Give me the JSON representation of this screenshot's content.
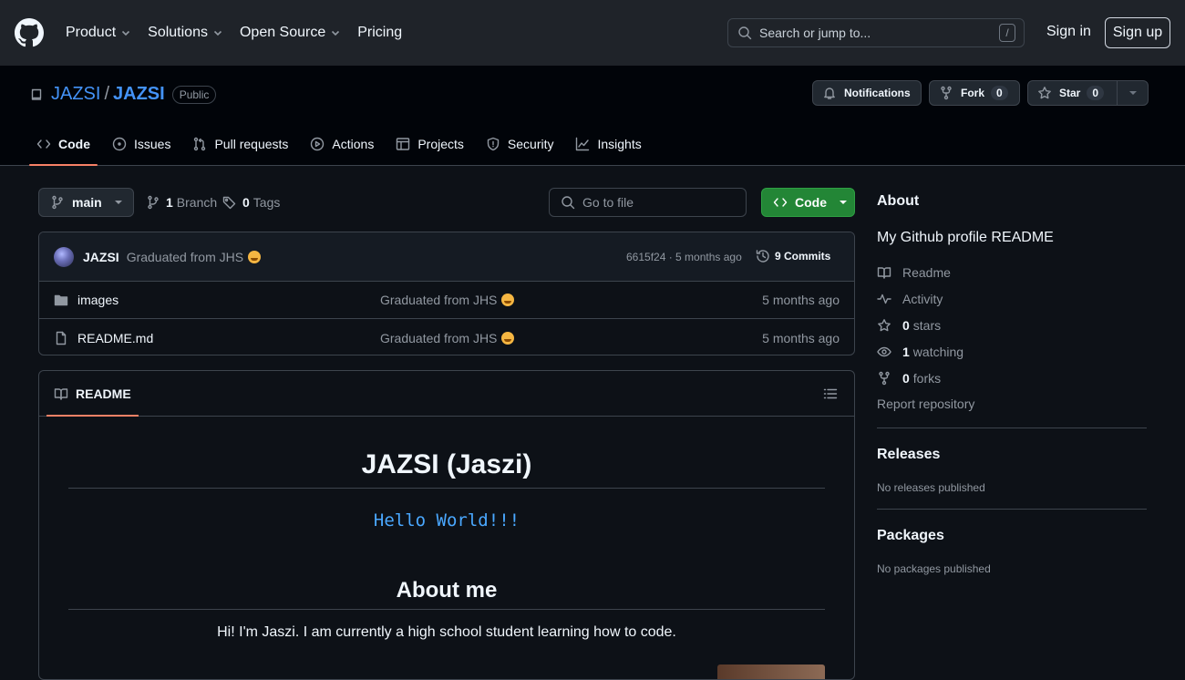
{
  "nav": {
    "product": "Product",
    "solutions": "Solutions",
    "open_source": "Open Source",
    "pricing": "Pricing"
  },
  "search": {
    "placeholder": "Search or jump to...",
    "shortcut": "/"
  },
  "auth": {
    "sign_in": "Sign in",
    "sign_up": "Sign up"
  },
  "repo": {
    "owner": "JAZSI",
    "separator": "/",
    "name": "JAZSI",
    "visibility": "Public",
    "notifications_label": "Notifications",
    "fork_label": "Fork",
    "fork_count": "0",
    "star_label": "Star",
    "star_count": "0"
  },
  "tabs": [
    {
      "label": "Code"
    },
    {
      "label": "Issues"
    },
    {
      "label": "Pull requests"
    },
    {
      "label": "Actions"
    },
    {
      "label": "Projects"
    },
    {
      "label": "Security"
    },
    {
      "label": "Insights"
    }
  ],
  "branch": {
    "current": "main",
    "branch_count": "1",
    "branch_label": "Branch",
    "tag_count": "0",
    "tag_label": "Tags",
    "goto_placeholder": "Go to file",
    "code_button": "Code"
  },
  "commit": {
    "user": "JAZSI",
    "message": "Graduated from JHS",
    "meta": "6615f24 · 5 months ago",
    "commits_count": "9 Commits"
  },
  "files": [
    {
      "name": "images",
      "type": "folder",
      "message": "Graduated from JHS",
      "age": "5 months ago"
    },
    {
      "name": "README.md",
      "type": "file",
      "message": "Graduated from JHS",
      "age": "5 months ago"
    }
  ],
  "readme": {
    "tab_label": "README",
    "h1": "JAZSI (Jaszi)",
    "code_line": "Hello World!!!",
    "h2": "About me",
    "paragraph": "Hi! I'm Jaszi. I am currently a high school student learning how to code."
  },
  "about": {
    "heading": "About",
    "description": "My Github profile README",
    "readme": "Readme",
    "activity": "Activity",
    "stars_count": "0",
    "stars_label": "stars",
    "watching_count": "1",
    "watching_label": "watching",
    "forks_count": "0",
    "forks_label": "forks",
    "report": "Report repository"
  },
  "releases": {
    "heading": "Releases",
    "empty": "No releases published"
  },
  "packages": {
    "heading": "Packages",
    "empty": "No packages published"
  },
  "colors": {
    "background": "#0d1117",
    "header": "#1f2329",
    "accent_link": "#4493f8",
    "green_button": "#238636",
    "tab_underline": "#f78166"
  }
}
